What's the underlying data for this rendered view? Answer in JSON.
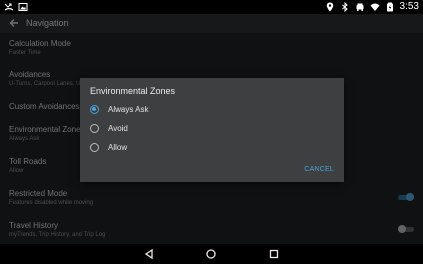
{
  "status_bar": {
    "time": "3:53",
    "left_icons": [
      "missed-call-icon",
      "image-icon"
    ],
    "right_icons": [
      "location-icon",
      "bluetooth-icon",
      "car-icon",
      "wifi-icon",
      "battery-icon"
    ]
  },
  "app_bar": {
    "title": "Navigation",
    "back_icon": "arrow-left-icon"
  },
  "settings": [
    {
      "title": "Calculation Mode",
      "subtitle": "Faster Time"
    },
    {
      "title": "Avoidances",
      "subtitle": "U-Turns, Carpool Lanes, Ur"
    },
    {
      "title": "Custom Avoidances",
      "subtitle": ""
    },
    {
      "title": "Environmental Zones",
      "subtitle": "Always Ask"
    },
    {
      "title": "Toll Roads",
      "subtitle": "Allow"
    },
    {
      "title": "Restricted Mode",
      "subtitle": "Features disabled while moving",
      "toggle": true
    },
    {
      "title": "Travel History",
      "subtitle": "myTrends, Trip History, and Trip Log",
      "toggle": false
    }
  ],
  "dialog": {
    "title": "Environmental Zones",
    "options": [
      {
        "label": "Always Ask",
        "checked": true
      },
      {
        "label": "Avoid",
        "checked": false
      },
      {
        "label": "Allow",
        "checked": false
      }
    ],
    "cancel_label": "CANCEL"
  },
  "colors": {
    "accent": "#4aa3d8",
    "background": "#1e2022",
    "dialog_background": "#3d3f41"
  },
  "nav_bar": {
    "buttons": [
      "back-triangle-icon",
      "home-circle-icon",
      "recents-square-icon"
    ]
  }
}
